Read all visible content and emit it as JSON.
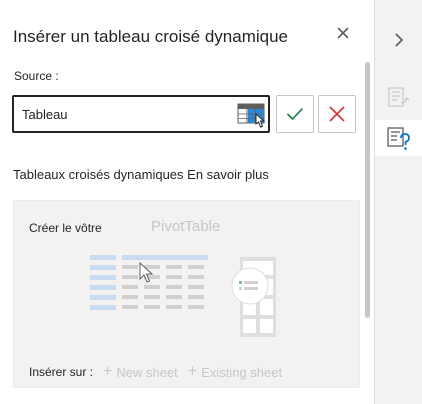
{
  "pane": {
    "title": "Insérer un tableau croisé dynamique",
    "source_label": "Source :",
    "source_value": "Tableau"
  },
  "section": {
    "heading": "Tableaux croisés dynamiques",
    "learn_more": "En savoir plus"
  },
  "card": {
    "create_label": "Créer le vôtre",
    "pivot_label": "PivotTable",
    "insert_label": "Insérer sur :",
    "new_sheet": "New sheet",
    "existing_sheet": "Existing sheet"
  },
  "icons": {
    "close": "close-icon",
    "range_select": "table-select-icon",
    "confirm": "checkmark-icon",
    "cancel": "cancel-x-icon",
    "collapse": "chevron-right-icon",
    "fields": "pivot-fields-icon",
    "help": "pivot-help-icon"
  },
  "colors": {
    "confirm": "#107c41",
    "cancel": "#d13438",
    "accent": "#0078d4"
  }
}
